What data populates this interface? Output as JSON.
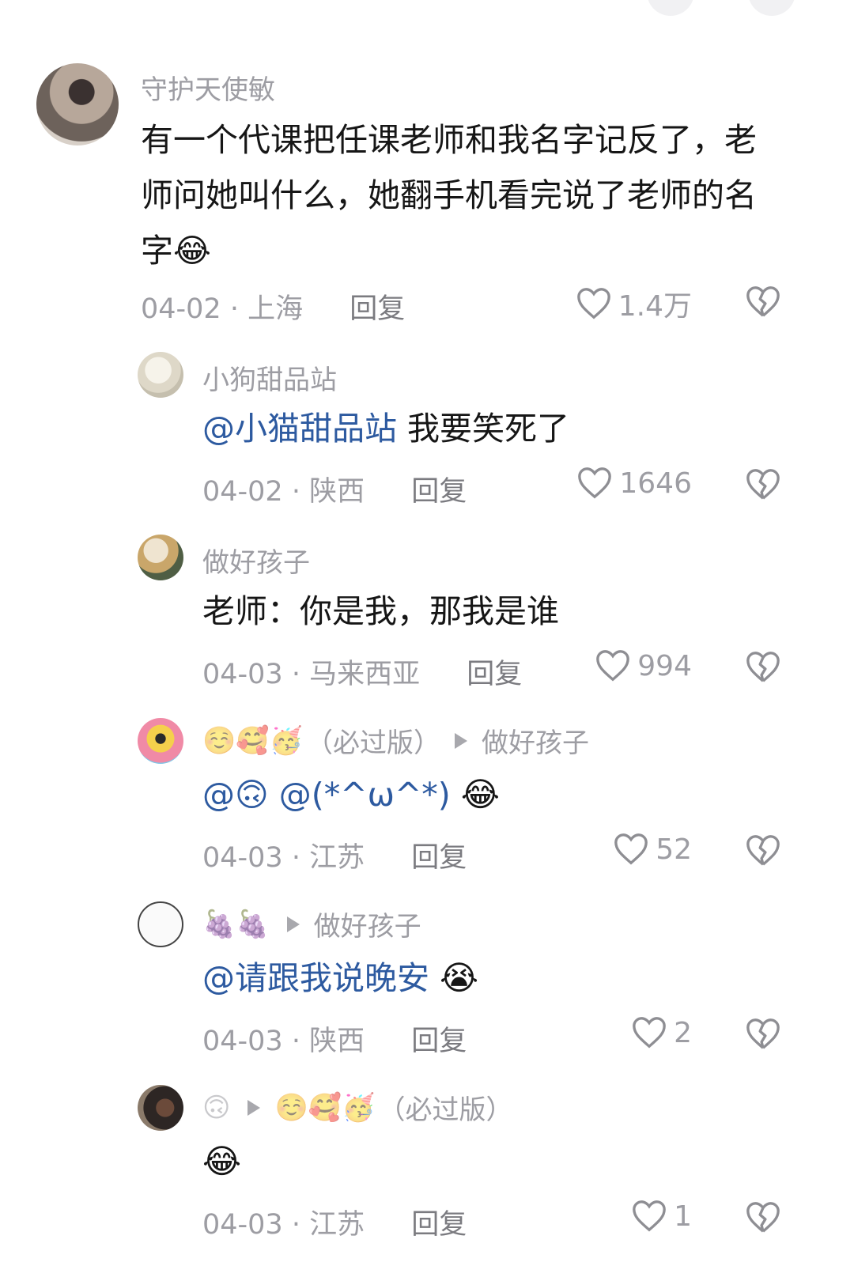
{
  "comments": [
    {
      "username": "守护天使敏",
      "text_lines": [
        "有一个代课把任课老师和我名字记反了，老",
        "师问她叫什么，她翻手机看完说了老师的名",
        "字😂"
      ],
      "date": "04-02",
      "location": "上海",
      "reply_label": "回复",
      "likes": "1.4万"
    },
    {
      "username": "小狗甜品站",
      "mention": "@小猫甜品站",
      "text": " 我要笑死了",
      "date": "04-02",
      "location": "陕西",
      "reply_label": "回复",
      "likes": "1646"
    },
    {
      "username": "做好孩子",
      "text": "老师：你是我，那我是谁",
      "date": "04-03",
      "location": "马来西亚",
      "reply_label": "回复",
      "likes": "994"
    },
    {
      "username_emojis": "☺️🥰🥳",
      "username": "（必过版）",
      "reply_to": "做好孩子",
      "mention": "@🙃 @(*^ω^*)",
      "text_emoji": "😂",
      "date": "04-03",
      "location": "江苏",
      "reply_label": "回复",
      "likes": "52"
    },
    {
      "username_emojis": "🍇🍇",
      "reply_to": "做好孩子",
      "mention": "@请跟我说晚安",
      "text_emoji": "😭",
      "date": "04-03",
      "location": "陕西",
      "reply_label": "回复",
      "likes": "2"
    },
    {
      "username_emojis": "🙃",
      "reply_to_emojis": "☺️🥰🥳",
      "reply_to": "（必过版）",
      "text_emoji": "😂",
      "date": "04-03",
      "location": "江苏",
      "reply_label": "回复",
      "likes": "1"
    }
  ],
  "colors": {
    "username": "#9d9da3",
    "mention": "#2d5aa0",
    "text": "#161616"
  },
  "icons": {
    "like": "heart-outline-icon",
    "dislike": "broken-heart-outline-icon"
  }
}
